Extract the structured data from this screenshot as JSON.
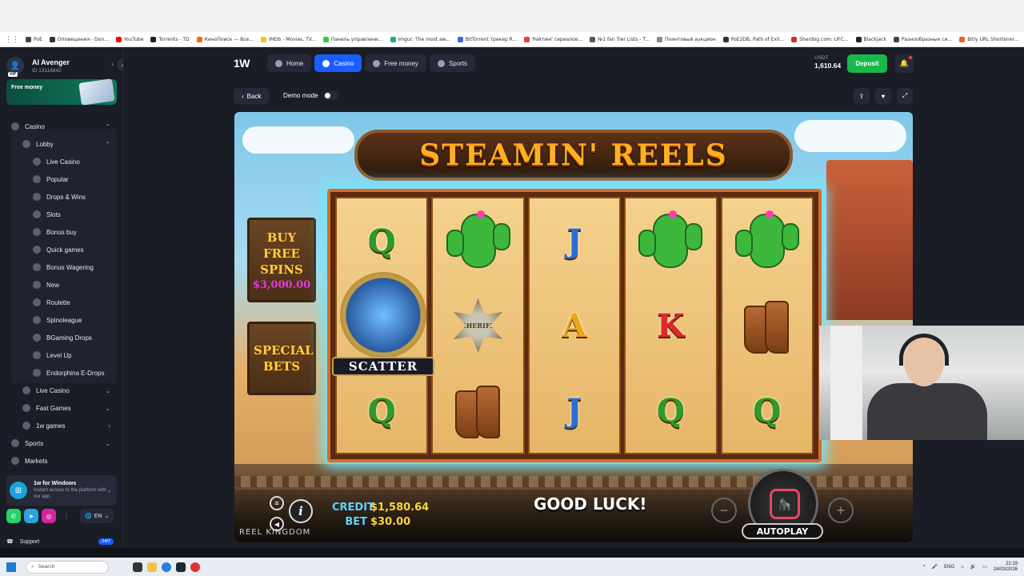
{
  "browser": {
    "bookmarks": [
      {
        "label": "PoE",
        "color": "#444444"
      },
      {
        "label": "Оповещения - Don...",
        "color": "#333333"
      },
      {
        "label": "YouTube",
        "color": "#ff0000"
      },
      {
        "label": "Torrents - TD",
        "color": "#222222"
      },
      {
        "label": "КиноПоиск — Все...",
        "color": "#ff6600"
      },
      {
        "label": "IMDb - Movies, TV...",
        "color": "#f5c518"
      },
      {
        "label": "Панель управлени...",
        "color": "#2ecc40"
      },
      {
        "label": "Imgur: The most aw...",
        "color": "#1bb76e"
      },
      {
        "label": "BitTorrent трекер R...",
        "color": "#3a6ad6"
      },
      {
        "label": "Рейтинг сериалов...",
        "color": "#e04040"
      },
      {
        "label": "№1 fan Tier Lists - T...",
        "color": "#555555"
      },
      {
        "label": "Поинтовый аукцион",
        "color": "#888888"
      },
      {
        "label": "PoE2DB, Path of Exil...",
        "color": "#333333"
      },
      {
        "label": "Sherdog.com: UFC...",
        "color": "#c0392b"
      },
      {
        "label": "Blackjack",
        "color": "#222222"
      },
      {
        "label": "Разнообразные си...",
        "color": "#444444"
      },
      {
        "label": "Bitly URL Shortener...",
        "color": "#ee6123"
      }
    ]
  },
  "sidebar": {
    "profile": {
      "name": "AI Avenger",
      "id": "ID 13116842",
      "badge": "VIP"
    },
    "free_money": "Free money",
    "nav": [
      {
        "label": "Casino",
        "level": 1,
        "chevron": "up",
        "icon": "casino-icon"
      },
      {
        "label": "Lobby",
        "level": 2,
        "chevron": "up",
        "icon": "lobby-icon"
      },
      {
        "label": "Live Casino",
        "level": 3,
        "icon": "live-casino-icon"
      },
      {
        "label": "Popular",
        "level": 3,
        "icon": "popular-icon"
      },
      {
        "label": "Drops & Wins",
        "level": 3,
        "icon": "drops-icon"
      },
      {
        "label": "Slots",
        "level": 3,
        "icon": "slots-icon"
      },
      {
        "label": "Bonus buy",
        "level": 3,
        "icon": "bonus-buy-icon"
      },
      {
        "label": "Quick games",
        "level": 3,
        "icon": "quick-games-icon"
      },
      {
        "label": "Bonus Wagering",
        "level": 3,
        "icon": "bonus-wagering-icon"
      },
      {
        "label": "New",
        "level": 3,
        "icon": "new-icon"
      },
      {
        "label": "Roulette",
        "level": 3,
        "icon": "roulette-icon"
      },
      {
        "label": "Spinoleague",
        "level": 3,
        "icon": "spinoleague-icon"
      },
      {
        "label": "BGaming Drops",
        "level": 3,
        "icon": "bgaming-icon"
      },
      {
        "label": "Level Up",
        "level": 3,
        "icon": "level-up-icon"
      },
      {
        "label": "Endorphina E-Drops",
        "level": 3,
        "icon": "endorphina-icon"
      },
      {
        "label": "Live Casino",
        "level": 2,
        "chevron": "down",
        "icon": "live-casino-icon"
      },
      {
        "label": "Fast Games",
        "level": 2,
        "chevron": "down",
        "icon": "fast-games-icon"
      },
      {
        "label": "1w games",
        "level": 2,
        "chevron": "right",
        "icon": "1w-games-icon"
      },
      {
        "label": "Sports",
        "level": 1,
        "chevron": "down",
        "icon": "sports-icon"
      },
      {
        "label": "Markets",
        "level": 1,
        "icon": "markets-icon"
      }
    ],
    "windows_promo": {
      "title": "1w for Windows",
      "text": "Instant access to the platform with our app"
    },
    "language": "EN",
    "support": {
      "label": "Support",
      "badge": "24/7"
    }
  },
  "header": {
    "logo": "1W",
    "tabs": [
      {
        "label": "Home",
        "active": false,
        "icon": "home-icon"
      },
      {
        "label": "Casino",
        "active": true,
        "icon": "casino-icon"
      },
      {
        "label": "Free money",
        "active": false,
        "icon": "gift-icon"
      },
      {
        "label": "Sports",
        "active": false,
        "icon": "sports-icon"
      }
    ],
    "wallet": {
      "currency": "USDT",
      "balance": "1,610.64"
    },
    "deposit_label": "Deposit"
  },
  "game_bar": {
    "back_label": "Back",
    "demo_label": "Demo mode"
  },
  "game": {
    "title": "STEAMIN' REELS",
    "buy_free_spins": "BUY FREE SPINS",
    "buy_price": "$3,000.00",
    "special_bets": "SPECIAL BETS",
    "scatter_label": "SCATTER",
    "sheriff_label": "SHERIFF",
    "reels": [
      [
        "Q",
        "scatter",
        "Q"
      ],
      [
        "cactus",
        "sheriff",
        "boots"
      ],
      [
        "J",
        "A",
        "J"
      ],
      [
        "cactus",
        "K",
        "Q"
      ],
      [
        "cactus",
        "boots",
        "Q"
      ]
    ],
    "credit_label": "CREDIT",
    "credit_value": "$1,580.64",
    "bet_label": "BET",
    "bet_value": "$30.00",
    "message": "GOOD LUCK!",
    "autoplay_label": "AUTOPLAY",
    "provider": "REEL KINGDOM"
  },
  "taskbar": {
    "search_placeholder": "Search",
    "lang": "ENG",
    "time": "22:19",
    "date": "24/03/2026"
  }
}
